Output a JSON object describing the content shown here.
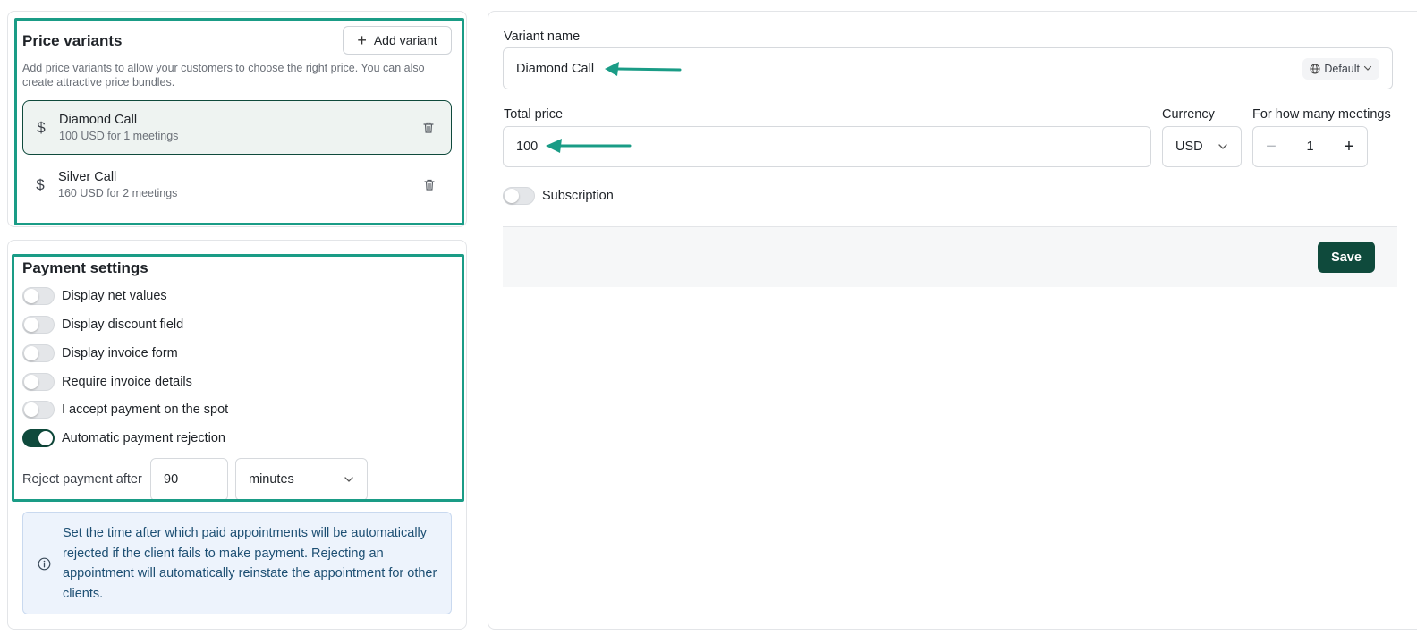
{
  "price_variants": {
    "title": "Price variants",
    "add_button_label": "Add variant",
    "description": "Add price variants to allow your customers to choose the right price. You can also create attractive price bundles.",
    "items": [
      {
        "name": "Diamond Call",
        "summary": "100 USD for 1 meetings",
        "selected": true,
        "icon": "dollar-icon"
      },
      {
        "name": "Silver Call",
        "summary": "160 USD for 2 meetings",
        "selected": false,
        "icon": "dollar-icon"
      }
    ]
  },
  "payment_settings": {
    "title": "Payment settings",
    "toggles": [
      {
        "label": "Display net values",
        "on": false
      },
      {
        "label": "Display discount field",
        "on": false
      },
      {
        "label": "Display invoice form",
        "on": false
      },
      {
        "label": "Require invoice details",
        "on": false
      },
      {
        "label": "I accept payment on the spot",
        "on": false
      },
      {
        "label": "Automatic payment rejection",
        "on": true
      }
    ],
    "reject_label": "Reject payment after",
    "reject_value": "90",
    "reject_unit": "minutes",
    "info_text": "Set the time after which paid appointments will be automatically rejected if the client fails to make payment. Rejecting an appointment will automatically reinstate the appointment for other clients."
  },
  "variant_form": {
    "name_label": "Variant name",
    "name_value": "Diamond Call",
    "language_selector": "Default",
    "total_price_label": "Total price",
    "total_price_value": "100",
    "currency_label": "Currency",
    "currency_value": "USD",
    "meetings_label": "For how many meetings",
    "meetings_value": "1",
    "subscription_label": "Subscription",
    "subscription_on": false,
    "save_label": "Save"
  },
  "colors": {
    "accent": "#0f4a3c",
    "highlight": "#1a9c86",
    "info_bg": "#edf3fc"
  }
}
